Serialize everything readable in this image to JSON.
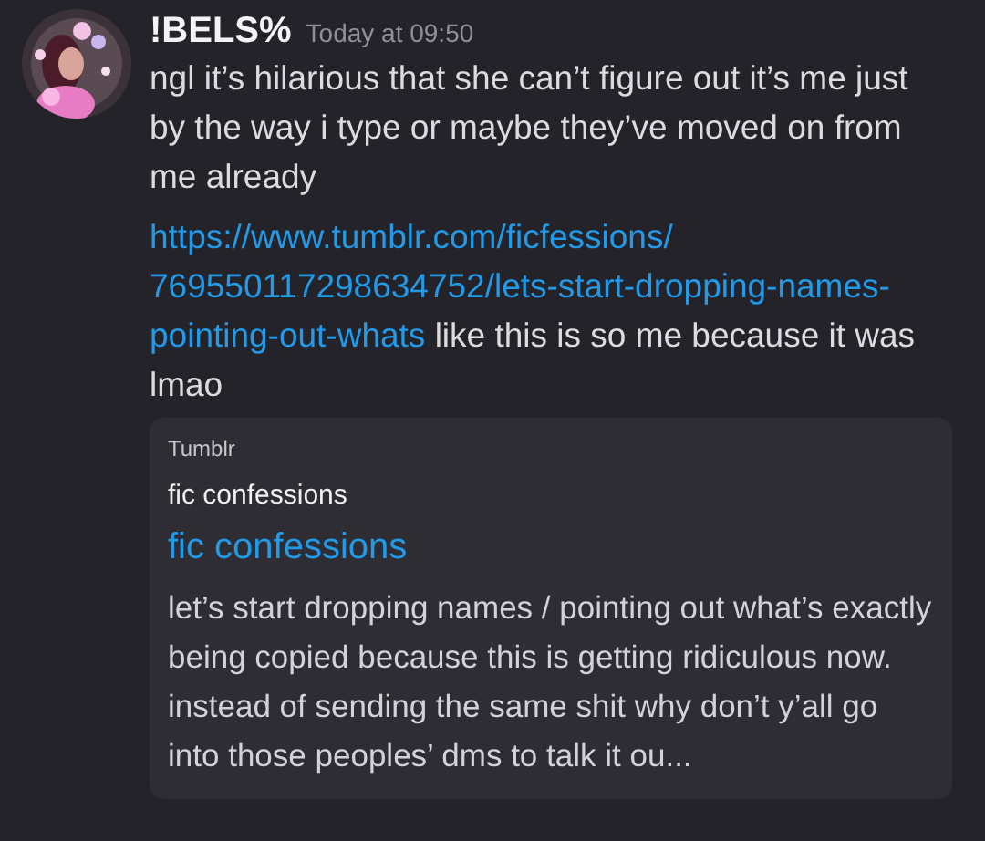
{
  "message": {
    "author": "!BELS%",
    "timestamp": "Today at 09:50",
    "text": "ngl it’s hilarious that she can’t figure out it’s me just by the way i type or maybe they’ve moved on from me already",
    "link": "https://www.tumblr.com/ficfessions/769550117298634752/lets-start-dropping-names-pointing-out-whats",
    "after_link": "like this is so me because it was lmao",
    "embed": {
      "provider": "Tumblr",
      "author": "fic confessions",
      "title": "fic confessions",
      "description": "let’s start dropping names / pointing out what’s exactly being copied because this is getting ridiculous now. instead of sending the same shit why don’t y’all go into those peoples’ dms to talk it ou..."
    }
  }
}
